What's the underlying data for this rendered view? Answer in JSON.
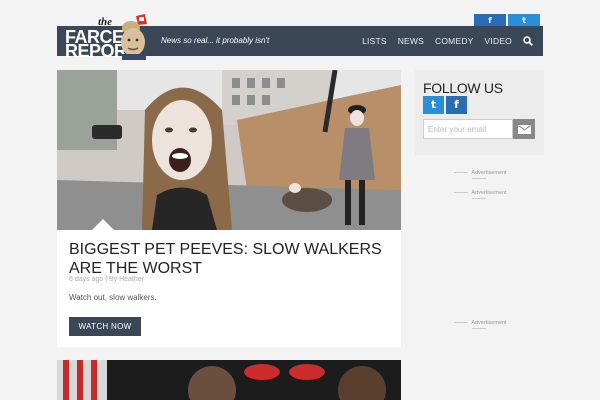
{
  "header": {
    "logo_the": "the",
    "logo_line1": "FARCE",
    "logo_line2": "REPORT",
    "tagline": "News so real... it probably isn't",
    "top_social": [
      {
        "icon": "facebook-icon",
        "glyph": "f"
      },
      {
        "icon": "twitter-icon",
        "glyph": "t"
      }
    ],
    "nav": [
      "LISTS",
      "NEWS",
      "COMEDY",
      "VIDEO"
    ]
  },
  "article": {
    "title": "BIGGEST PET PEEVES: SLOW WALKERS ARE THE WORST",
    "meta": "6 days ago  |  By Heather",
    "description": "Watch out, slow walkers.",
    "button_label": "WATCH NOW"
  },
  "sidebar": {
    "follow_title": "FOLLOW US",
    "social": [
      {
        "icon": "twitter-icon",
        "glyph": "t"
      },
      {
        "icon": "facebook-icon",
        "glyph": "f"
      }
    ],
    "email_placeholder": "Enter your email",
    "ads": [
      "Advertisement",
      "Advertisement",
      "Advertisement"
    ]
  },
  "colors": {
    "navbar": "#3b4656",
    "twitter": "#2a8fd6",
    "facebook": "#2a6db5",
    "background": "#f3f3f3"
  }
}
